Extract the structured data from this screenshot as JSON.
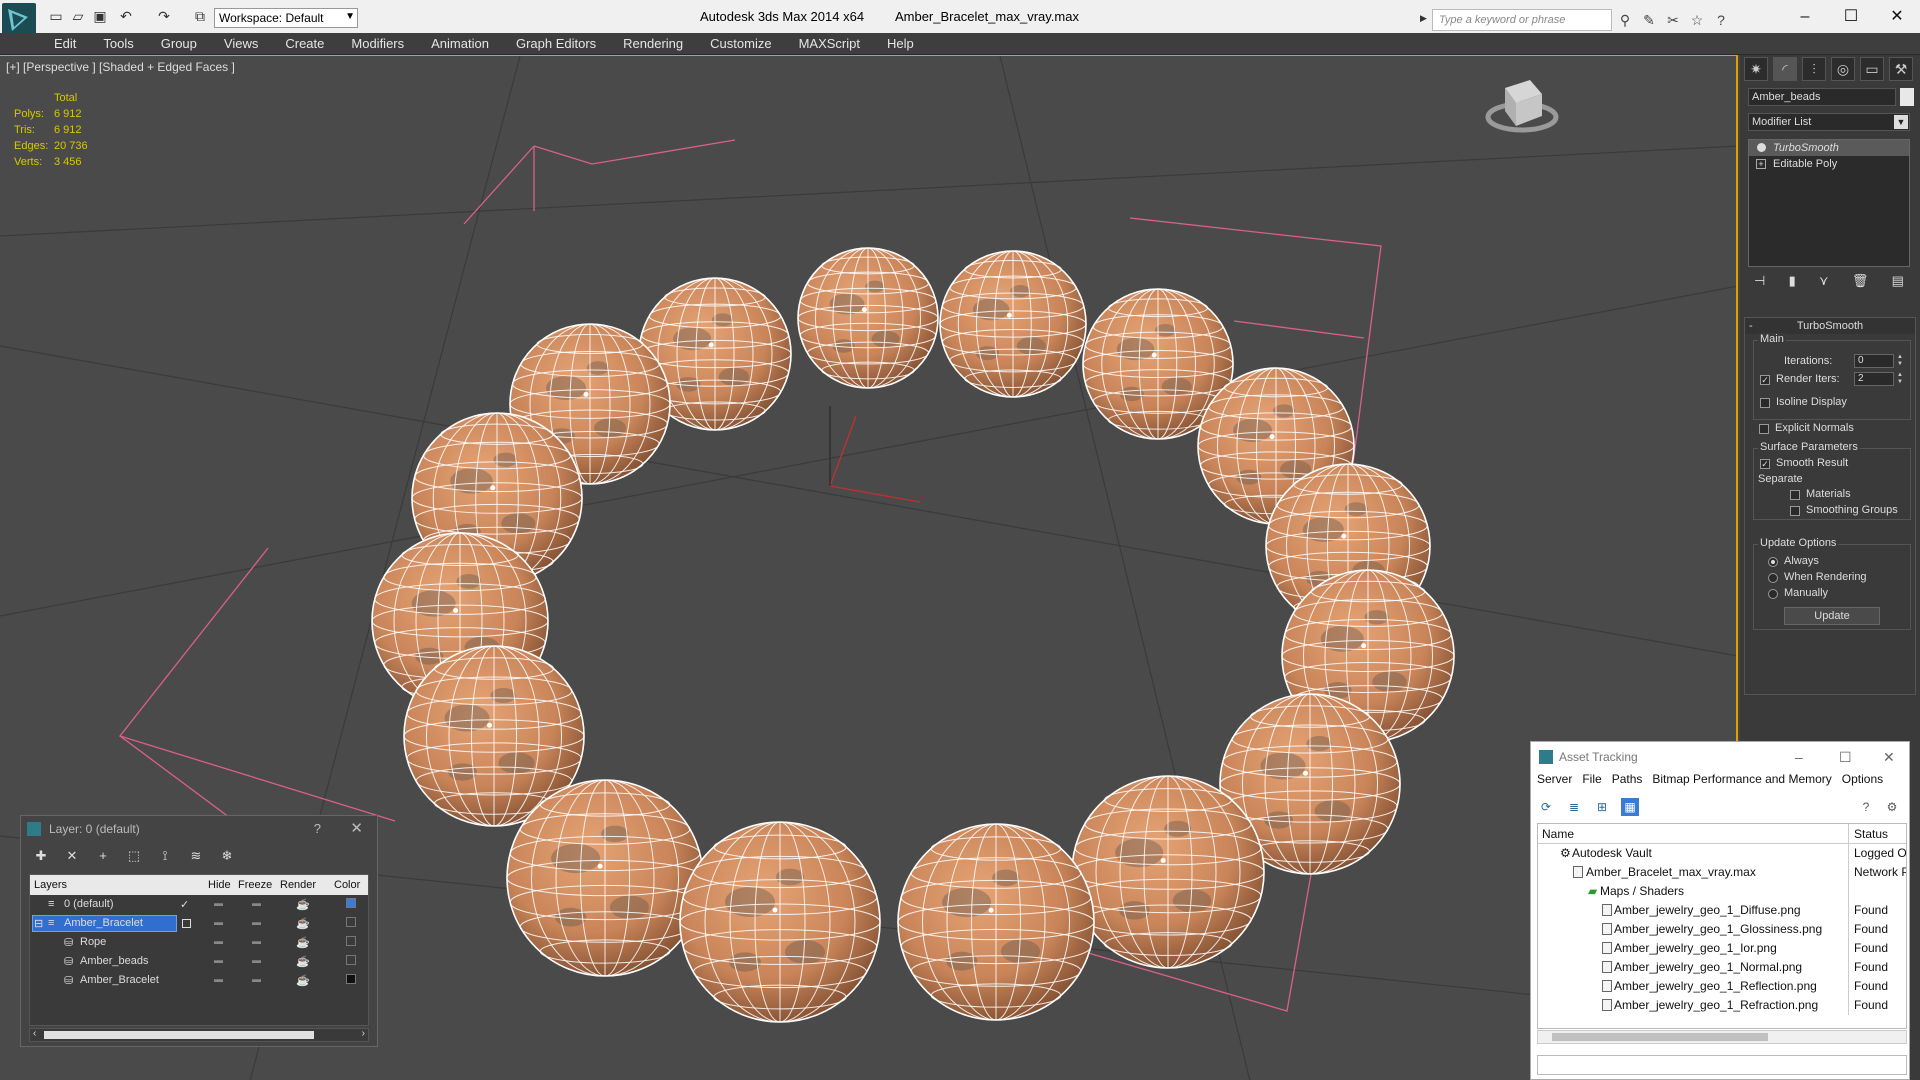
{
  "titlebar": {
    "workspace": "Workspace: Default",
    "app_name": "Autodesk 3ds Max  2014 x64",
    "file_name": "Amber_Bracelet_max_vray.max",
    "search_placeholder": "Type a keyword or phrase"
  },
  "menu": [
    "Edit",
    "Tools",
    "Group",
    "Views",
    "Create",
    "Modifiers",
    "Animation",
    "Graph Editors",
    "Rendering",
    "Customize",
    "MAXScript",
    "Help"
  ],
  "viewport": {
    "label": "[+] [Perspective ] [Shaded + Edged Faces ]",
    "stats": {
      "header": "Total",
      "rows": [
        {
          "k": "Polys:",
          "v": "6 912"
        },
        {
          "k": "Tris:",
          "v": "6 912"
        },
        {
          "k": "Edges:",
          "v": "20 736"
        },
        {
          "k": "Verts:",
          "v": "3 456"
        }
      ]
    },
    "colors": {
      "bead": "#c98559",
      "bead_shadow": "#8a5434",
      "bead_spot": "#6d5a4e",
      "grid": "#3c3c3c",
      "light_wire": "#e05a8a"
    }
  },
  "cmdpanel": {
    "object_name": "Amber_beads",
    "modifier_list": "Modifier List",
    "stack": [
      "TurboSmooth",
      "Editable Poly"
    ],
    "rollout": {
      "title": "TurboSmooth",
      "main": "Main",
      "iterations_label": "Iterations:",
      "iterations": "0",
      "render_iters_label": "Render Iters:",
      "render_iters": "2",
      "isoline": "Isoline Display",
      "explicit": "Explicit Normals",
      "surface_params": "Surface Parameters",
      "smooth_result": "Smooth Result",
      "separate": "Separate",
      "materials": "Materials",
      "smoothing_groups": "Smoothing Groups",
      "update_options": "Update Options",
      "always": "Always",
      "when_rendering": "When Rendering",
      "manually": "Manually",
      "update_btn": "Update"
    }
  },
  "layer_dialog": {
    "title": "Layer: 0 (default)",
    "help": "?",
    "columns": [
      "Layers",
      "Hide",
      "Freeze",
      "Render",
      "Color"
    ],
    "rows": [
      {
        "name": "0 (default)",
        "color": "#3a7bd5"
      },
      {
        "name": "Amber_Bracelet",
        "color": "#3a3a3a"
      },
      {
        "name": "Rope",
        "color": "#3a3a3a"
      },
      {
        "name": "Amber_beads",
        "color": "#3a3a3a"
      },
      {
        "name": "Amber_Bracelet",
        "color": "#111111"
      }
    ]
  },
  "asset_tracking": {
    "title": "Asset Tracking",
    "menu": [
      "Server",
      "File",
      "Paths",
      "Bitmap Performance and Memory",
      "Options"
    ],
    "columns": [
      "Name",
      "Status"
    ],
    "rows": [
      {
        "name": "Autodesk Vault",
        "status": "Logged Ou",
        "indent": 0
      },
      {
        "name": "Amber_Bracelet_max_vray.max",
        "status": "Network P",
        "indent": 1
      },
      {
        "name": "Maps / Shaders",
        "status": "",
        "indent": 2
      },
      {
        "name": "Amber_jewelry_geo_1_Diffuse.png",
        "status": "Found",
        "indent": 3
      },
      {
        "name": "Amber_jewelry_geo_1_Glossiness.png",
        "status": "Found",
        "indent": 3
      },
      {
        "name": "Amber_jewelry_geo_1_Ior.png",
        "status": "Found",
        "indent": 3
      },
      {
        "name": "Amber_jewelry_geo_1_Normal.png",
        "status": "Found",
        "indent": 3
      },
      {
        "name": "Amber_jewelry_geo_1_Reflection.png",
        "status": "Found",
        "indent": 3
      },
      {
        "name": "Amber_jewelry_geo_1_Refraction.png",
        "status": "Found",
        "indent": 3
      }
    ]
  }
}
